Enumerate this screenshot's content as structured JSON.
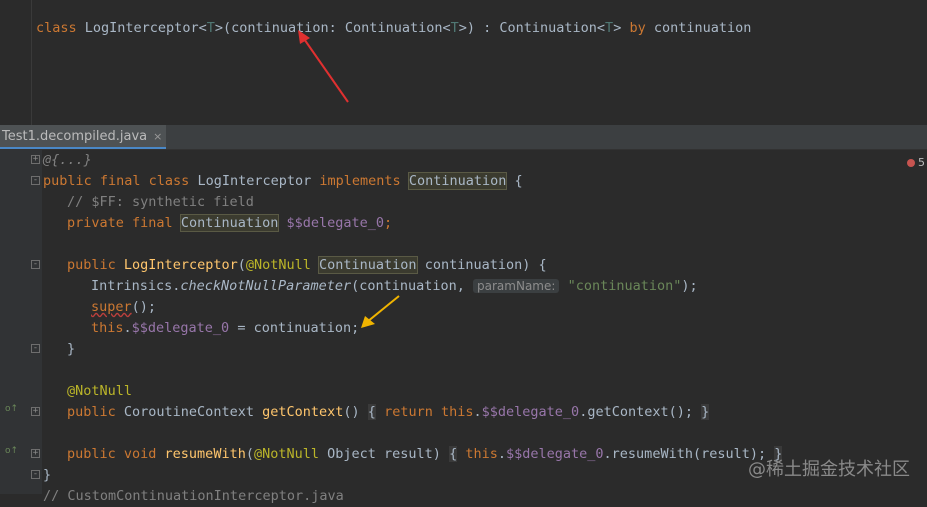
{
  "top_code": {
    "class_kw": "class",
    "class_name": "LogInterceptor",
    "lt": "<",
    "T1": "T",
    "gt_paren": ">(",
    "param": "continuation",
    "colon_type": ": Continuation<",
    "T2": "T",
    "close": ">) : Continuation<",
    "T3": "T",
    "close2": ">",
    "by_kw": "by",
    "delegate": "continuation"
  },
  "tab": {
    "label": "Test1.decompiled.java",
    "close": "×"
  },
  "error_badge": "5",
  "code": {
    "l1": "@{...}",
    "l2_public": "public final class",
    "l2_name": "LogInterceptor",
    "l2_impl": "implements",
    "l2_type": "Continuation",
    "l2_end": " {",
    "l3": "// $FF: synthetic field",
    "l4_kw": "private final",
    "l4_type": "Continuation",
    "l4_field": "$$delegate_0",
    "l4_end": ";",
    "l6_kw": "public",
    "l6_name": "LogInterceptor",
    "l6_open": "(",
    "l6_ann": "@NotNull",
    "l6_type": "Continuation",
    "l6_rest": " continuation) {",
    "l7_cls": "Intrinsics.",
    "l7_fn": "checkNotNullParameter",
    "l7_arg": "(continuation,",
    "l7_hint": "paramName:",
    "l7_str": "\"continuation\"",
    "l7_end": ");",
    "l8_kw": "super",
    "l8_end": "();",
    "l9_kw": "this",
    "l9_dot": ".",
    "l9_field": "$$delegate_0",
    "l9_rest": " = continuation;",
    "l10": "}",
    "l12": "@NotNull",
    "l13_kw": "public",
    "l13_type": " CoroutineContext ",
    "l13_fn": "getContext",
    "l13_paren": "()",
    "l13_ob": "{",
    "l13_ret": "return",
    "l13_this": "this",
    "l13_field": "$$delegate_0",
    "l13_call": ".getContext();",
    "l13_cb": "}",
    "l15_kw": "public void",
    "l15_fn": "resumeWith",
    "l15_open": "(",
    "l15_ann": "@NotNull",
    "l15_rest": " Object result)",
    "l15_ob": "{",
    "l15_this": "this",
    "l15_field": "$$delegate_0",
    "l15_call": ".resumeWith(result);",
    "l15_cb": "}",
    "l16": "}",
    "l17": "// CustomContinuationInterceptor.java"
  },
  "watermark": "@稀土掘金技术社区",
  "colors": {
    "background": "#2b2b2b",
    "keyword": "#cc7832",
    "function": "#ffc66d",
    "field": "#9876aa",
    "annotation": "#bbb529",
    "string": "#6a8759",
    "arrow_red": "#e03030",
    "arrow_yellow": "#f0b400"
  }
}
